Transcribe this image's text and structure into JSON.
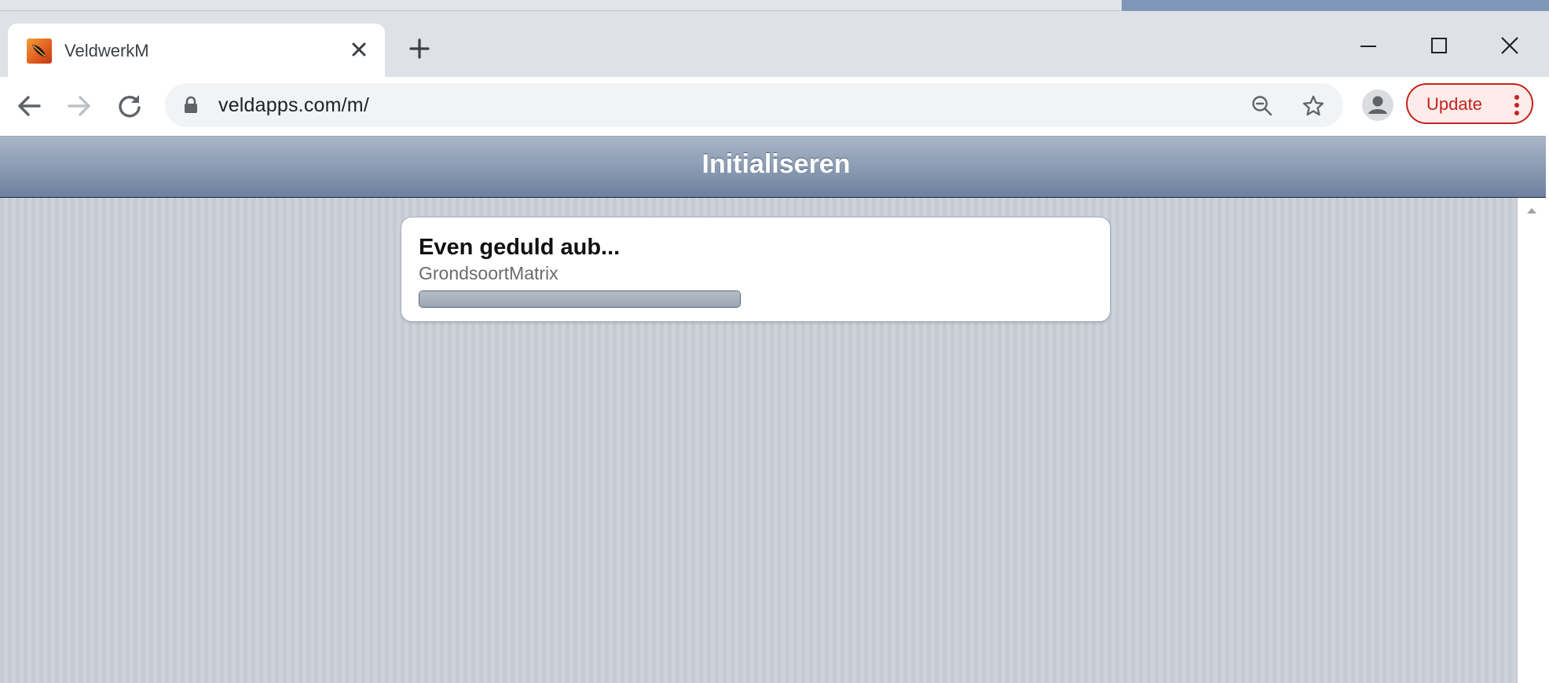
{
  "browser": {
    "tab": {
      "title": "VeldwerkM",
      "favicon": "veldwerk-leaf-icon"
    },
    "toolbar": {
      "url": "veldapps.com/m/",
      "update_label": "Update"
    },
    "colors": {
      "accent": "#c5221f",
      "tab_strip": "#dee1e6"
    }
  },
  "app": {
    "header_title": "Initialiseren",
    "colors": {
      "header_top": "#aab5c8",
      "header_bottom": "#6d809f",
      "background": "#c9ced7"
    }
  },
  "loading": {
    "title": "Even geduld aub...",
    "subtitle": "GrondsoortMatrix",
    "progress": 1.0
  }
}
